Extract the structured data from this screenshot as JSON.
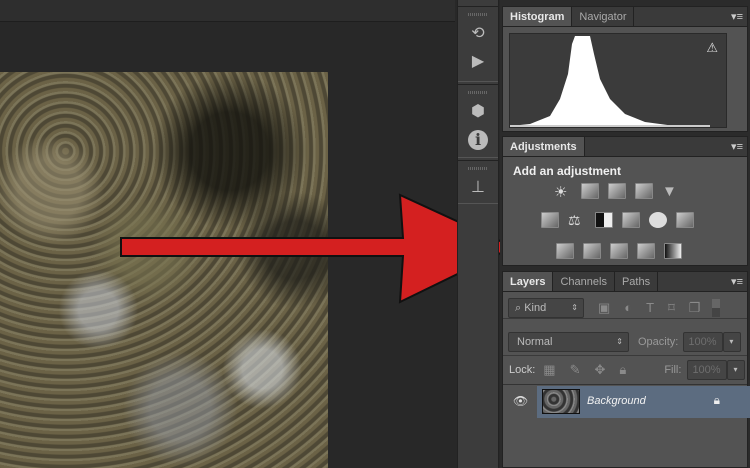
{
  "histogram_panel": {
    "tabs": [
      "Histogram",
      "Navigator"
    ],
    "warning_icon": "warning-triangle-icon"
  },
  "adjustments_panel": {
    "tab": "Adjustments",
    "title": "Add an adjustment",
    "rows": [
      [
        "brightness-contrast",
        "levels",
        "curves",
        "exposure",
        "vibrance"
      ],
      [
        "hue-saturation",
        "color-balance",
        "black-white",
        "photo-filter",
        "channel-mixer",
        "color-lookup"
      ],
      [
        "invert",
        "posterize",
        "threshold",
        "selective-color",
        "gradient-map"
      ]
    ]
  },
  "layers_panel": {
    "tabs": [
      "Layers",
      "Channels",
      "Paths"
    ],
    "filter_kind": "Kind",
    "blend_mode": "Normal",
    "opacity_label": "Opacity:",
    "opacity_value": "100%",
    "lock_label": "Lock:",
    "fill_label": "Fill:",
    "fill_value": "100%",
    "layers": [
      {
        "name": "Background",
        "visible": true,
        "locked": true
      }
    ]
  },
  "colors": {
    "arrow": "#d42020",
    "selected_layer": "#5c6c80",
    "panel": "#535353"
  }
}
